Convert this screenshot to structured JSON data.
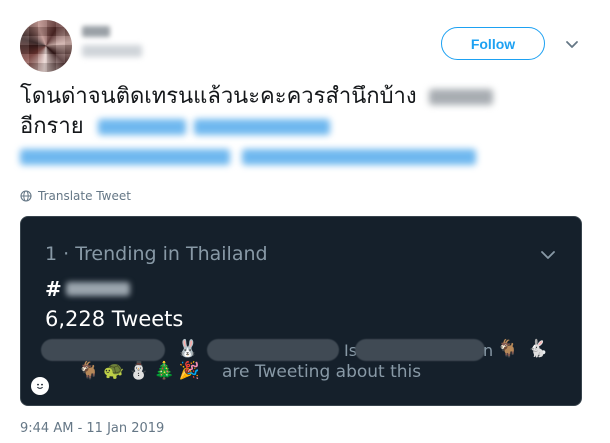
{
  "tweet": {
    "follow_label": "Follow",
    "text_line1": "โดนด่าจนติดเทรนแล้วนะคะควรสำนึกบ้าง",
    "text_line2": "อีกราย",
    "translate_label": "Translate Tweet",
    "timestamp": "9:44 AM - 11 Jan 2019"
  },
  "trend_card": {
    "rank_location": "1 · Trending in Thailand",
    "hashtag_prefix": "#",
    "tweet_count": "6,228 Tweets",
    "is_fragment": "Is",
    "n_fragment": "n",
    "about_text": "are Tweeting about this",
    "emojis_top": [
      "🐰",
      "🐐",
      "🐇"
    ],
    "emojis_bottom": [
      "🐐",
      "🐢",
      "⛄",
      "🎄",
      "🎉"
    ]
  },
  "icons": {
    "caret": "chevron-down-icon",
    "translate": "globe-icon",
    "emoji_face": "emoji-face-icon"
  },
  "colors": {
    "accent": "#1da1f2",
    "card_bg": "#15202b",
    "muted": "#657786"
  }
}
